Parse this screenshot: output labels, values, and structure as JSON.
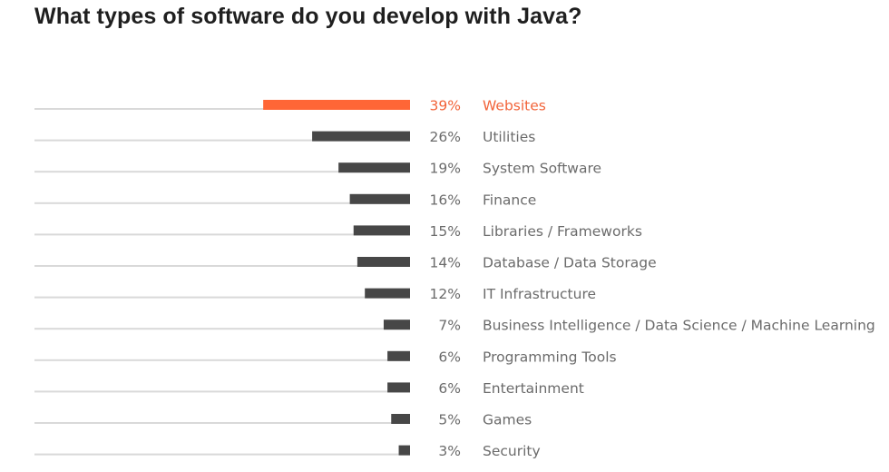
{
  "chart_data": {
    "type": "bar",
    "orientation": "horizontal",
    "title": "What types of software do you develop with Java?",
    "xlabel": "",
    "ylabel": "",
    "unit": "%",
    "xlim": [
      0,
      100
    ],
    "grid": false,
    "legend": "none",
    "highlight_index": 0,
    "colors": {
      "highlight": "#ff6636",
      "bar": "#474747",
      "baseline": "#d9d9d9",
      "text": "#6b6b6b",
      "highlight_text": "#f2643a"
    },
    "categories": [
      "Websites",
      "Utilities",
      "System Software",
      "Finance",
      "Libraries / Frameworks",
      "Database / Data Storage",
      "IT Infrastructure",
      "Business Intelligence / Data Science / Machine Learning",
      "Programming Tools",
      "Entertainment",
      "Games",
      "Security"
    ],
    "values": [
      39,
      26,
      19,
      16,
      15,
      14,
      12,
      7,
      6,
      6,
      5,
      3
    ],
    "value_labels": [
      "39%",
      "26%",
      "19%",
      "16%",
      "15%",
      "14%",
      "12%",
      "7%",
      "6%",
      "6%",
      "5%",
      "3%"
    ]
  }
}
